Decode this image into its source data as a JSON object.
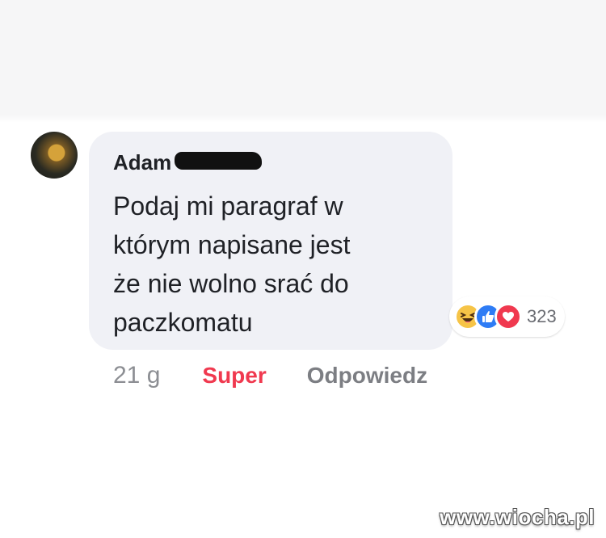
{
  "comment": {
    "author": "Adam",
    "text": "Podaj mi paragraf w\nktórym napisane jest\nże nie wolno srać do\npaczkomatu"
  },
  "reactions": {
    "icons": [
      "haha-icon",
      "like-icon",
      "love-icon"
    ],
    "count": "323"
  },
  "actions": {
    "time": "21 g",
    "super_label": "Super",
    "reply_label": "Odpowiedz"
  },
  "watermark": "www.wiocha.pl",
  "colors": {
    "bubble": "#f0f1f6",
    "super": "#f0394f",
    "like": "#2e7cf5",
    "haha": "#f6c447"
  }
}
